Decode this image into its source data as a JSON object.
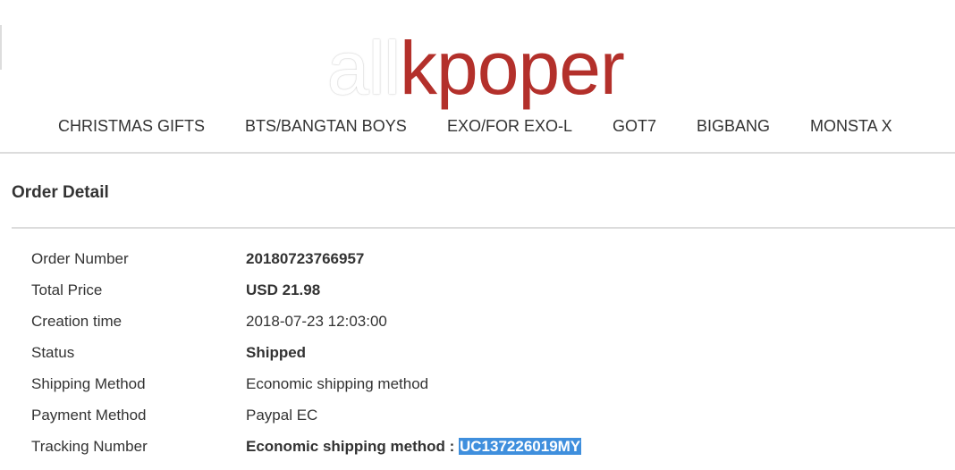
{
  "logo": {
    "part_a": "all",
    "part_b": "kpoper",
    "colors": {
      "part_a": "#ffffff",
      "part_b": "#b3302b"
    }
  },
  "nav": {
    "items": [
      {
        "label": "CHRISTMAS GIFTS"
      },
      {
        "label": "BTS/BANGTAN BOYS"
      },
      {
        "label": "EXO/FOR EXO-L"
      },
      {
        "label": "GOT7"
      },
      {
        "label": "BIGBANG"
      },
      {
        "label": "MONSTA X"
      }
    ]
  },
  "order_detail": {
    "title": "Order Detail",
    "rows": [
      {
        "label": "Order Number",
        "value": "20180723766957"
      },
      {
        "label": "Total Price",
        "value": "USD 21.98"
      },
      {
        "label": "Creation time",
        "value": "2018-07-23 12:03:00"
      },
      {
        "label": "Status",
        "value": "Shipped"
      },
      {
        "label": "Shipping Method",
        "value": "Economic shipping method"
      },
      {
        "label": "Payment Method",
        "value": "Paypal EC"
      },
      {
        "label": "Tracking Number",
        "value_prefix": "Economic shipping method : ",
        "tracking_code": "UC137226019MY"
      }
    ]
  },
  "colors": {
    "selection_highlight": "#3f8fdd",
    "divider": "#dcdcdc",
    "text": "#333333"
  }
}
